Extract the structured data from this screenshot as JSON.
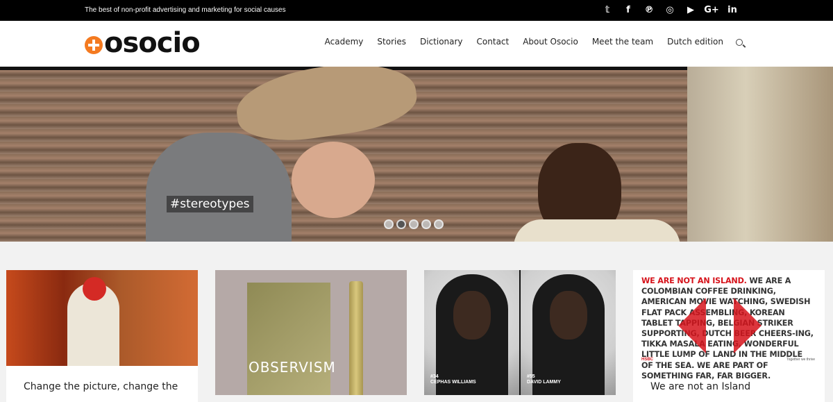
{
  "topbar": {
    "tagline": "The best of non-profit advertising and marketing for social causes",
    "social": [
      {
        "icon": "twitter-icon",
        "glyph": "𝕥"
      },
      {
        "icon": "facebook-icon",
        "glyph": "f"
      },
      {
        "icon": "pinterest-icon",
        "glyph": "℗"
      },
      {
        "icon": "instagram-icon",
        "glyph": "◎"
      },
      {
        "icon": "youtube-icon",
        "glyph": "▶"
      },
      {
        "icon": "google-plus-icon",
        "glyph": "G+"
      },
      {
        "icon": "linkedin-icon",
        "glyph": "in"
      }
    ]
  },
  "header": {
    "logo_text": "osocio",
    "nav": [
      "Academy",
      "Stories",
      "Dictionary",
      "Contact",
      "About Osocio",
      "Meet the team",
      "Dutch edition"
    ]
  },
  "hero": {
    "hashtag": "#stereotypes",
    "slides": 5,
    "active_slide": 2
  },
  "cards": [
    {
      "title": "Change the picture, change the"
    },
    {
      "title": "",
      "image_text": "OBSERVISM"
    },
    {
      "title": "",
      "captions": [
        "#34\nCEPHAS WILLIAMS",
        "#55\nDAVID LAMMY"
      ]
    },
    {
      "title": "We are not an Island",
      "poster_red": "WE ARE NOT AN ISLAND.",
      "poster_text": " WE ARE A COLOMBIAN COFFEE DRINKING, AMERICAN MOVIE WATCHING, SWEDISH FLAT PACK ASSEMBLING, KOREAN TABLET TAPPING, BELGIAN STRIKER SUPPORTING, DUTCH BEER CHEERS-ING, TIKKA MASALA EATING, WONDERFUL LITTLE LUMP OF LAND IN THE MIDDLE OF THE SEA. WE ARE PART OF SOMETHING FAR, FAR BIGGER.",
      "brand": "HSBC",
      "sub": "Together we thrive"
    }
  ],
  "colors": {
    "accent": "#f47a20",
    "topbar": "#000000",
    "hsbc_red": "#d6141c"
  }
}
